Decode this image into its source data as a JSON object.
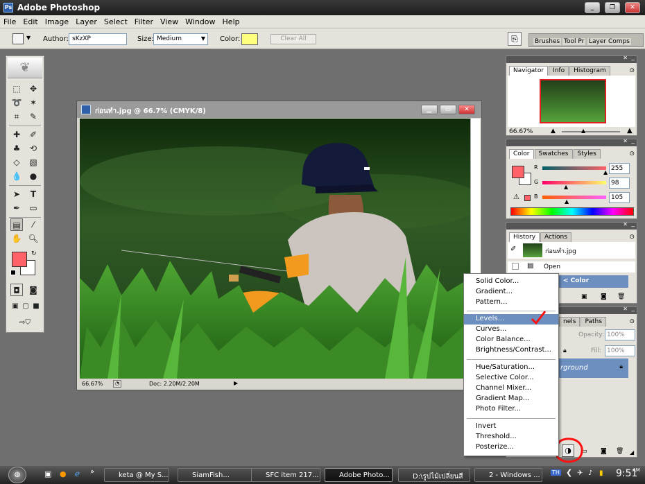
{
  "app": {
    "title": "Adobe Photoshop"
  },
  "menu": [
    "File",
    "Edit",
    "Image",
    "Layer",
    "Select",
    "Filter",
    "View",
    "Window",
    "Help"
  ],
  "options": {
    "author_label": "Author:",
    "author_value": "sKzXP",
    "size_label": "Size:",
    "size_value": "Medium",
    "color_label": "Color:",
    "color_swatch": "#ffff80",
    "clear_all": "Clear All"
  },
  "palette_well": [
    "Brushes",
    "Tool Pr",
    "Layer Comps"
  ],
  "document": {
    "title": "ก่อนทำ.jpg @ 66.7% (CMYK/8)",
    "zoom": "66.67%",
    "doc_info": "Doc: 2.20M/2.20M"
  },
  "navigator": {
    "tabs": [
      "Navigator",
      "Info",
      "Histogram"
    ],
    "zoom": "66.67%"
  },
  "color_panel": {
    "tabs": [
      "Color",
      "Swatches",
      "Styles"
    ],
    "r_label": "R",
    "g_label": "G",
    "b_label": "B",
    "r": "255",
    "g": "98",
    "b": "105",
    "fg": "#ff6269"
  },
  "history": {
    "tabs": [
      "History",
      "Actions"
    ],
    "snapshot": "ก่อนทำ.jpg",
    "items": [
      "Open",
      "< Color"
    ]
  },
  "layers": {
    "tabs": [
      "nels",
      "Paths"
    ],
    "opacity_label": "Opacity:",
    "opacity": "100%",
    "fill_label": "Fill:",
    "fill": "100%",
    "layer_name": "rground"
  },
  "context_menu": {
    "group1": [
      "Solid Color...",
      "Gradient...",
      "Pattern..."
    ],
    "group2": [
      "Levels...",
      "Curves...",
      "Color Balance...",
      "Brightness/Contrast..."
    ],
    "group3": [
      "Hue/Saturation...",
      "Selective Color...",
      "Channel Mixer...",
      "Gradient Map...",
      "Photo Filter..."
    ],
    "group4": [
      "Invert",
      "Threshold...",
      "Posterize..."
    ],
    "highlighted": "Levels..."
  },
  "taskbar": {
    "items": [
      "keta @ My S...",
      "SiamFish...",
      "SFC item 217...",
      "Adobe Photo...",
      "D:\\รูปไม้เปลี่ยนสี",
      "2 - Windows ..."
    ],
    "clock": "9:51",
    "ampm": "AM",
    "tray_label": "TH"
  }
}
